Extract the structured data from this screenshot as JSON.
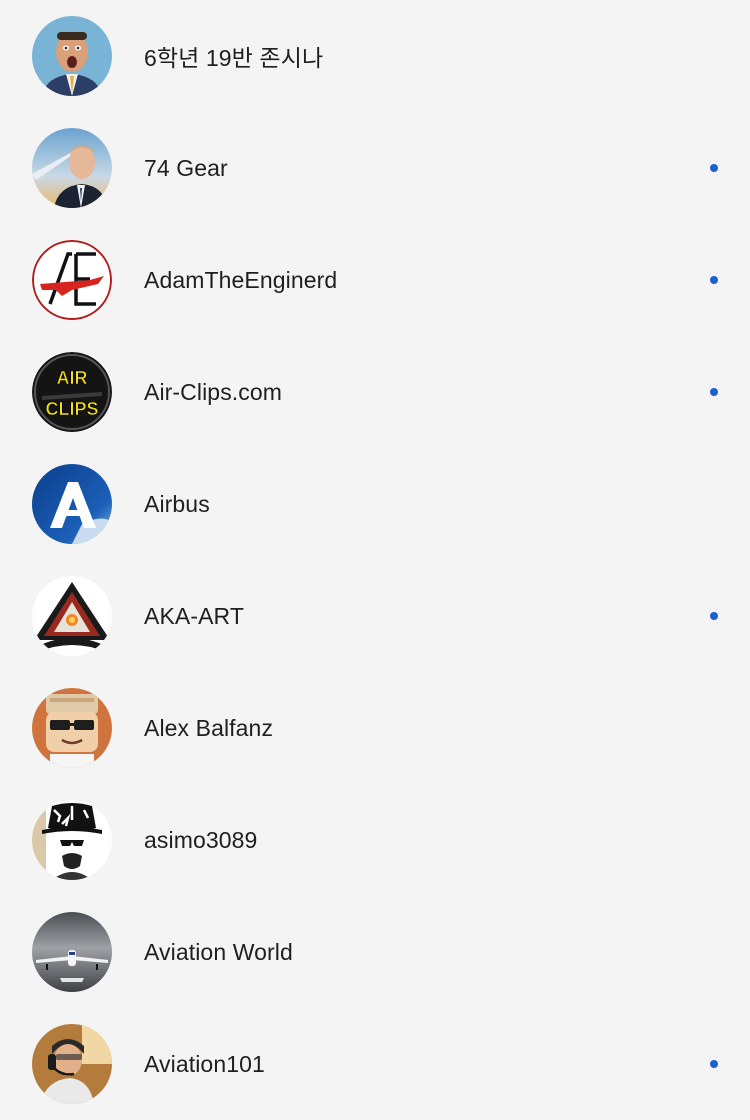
{
  "subscriptions": [
    {
      "name": "6학년 19반 존시나",
      "avatar_icon": "cena-avatar-icon",
      "new_content": false
    },
    {
      "name": "74 Gear",
      "avatar_icon": "pilot-avatar-icon",
      "new_content": true
    },
    {
      "name": "AdamTheEnginerd",
      "avatar_icon": "ae-logo-icon",
      "new_content": true
    },
    {
      "name": "Air-Clips.com",
      "avatar_icon": "air-clips-logo-icon",
      "new_content": true
    },
    {
      "name": "Airbus",
      "avatar_icon": "airbus-logo-icon",
      "new_content": false
    },
    {
      "name": "AKA-ART",
      "avatar_icon": "aka-art-logo-icon",
      "new_content": true
    },
    {
      "name": "Alex Balfanz",
      "avatar_icon": "roblox-avatar-icon",
      "new_content": false
    },
    {
      "name": "asimo3089",
      "avatar_icon": "hat-avatar-icon",
      "new_content": false
    },
    {
      "name": "Aviation World",
      "avatar_icon": "airplane-runway-icon",
      "new_content": false
    },
    {
      "name": "Aviation101",
      "avatar_icon": "cockpit-pilot-icon",
      "new_content": true
    }
  ],
  "colors": {
    "background": "#f4f4f4",
    "text": "#1f1f1f",
    "new_dot": "#1a5fd3"
  }
}
